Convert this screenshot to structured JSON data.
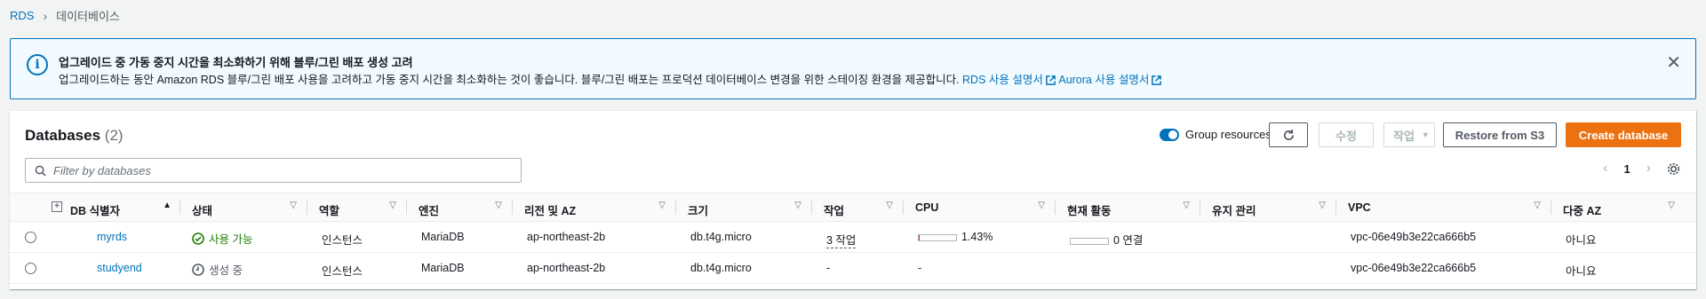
{
  "breadcrumb": {
    "root": "RDS",
    "current": "데이터베이스"
  },
  "banner": {
    "title": "업그레이드 중 가동 중지 시간을 최소화하기 위해 블루/그린 배포 생성 고려",
    "description": "업그레이드하는 동안 Amazon RDS 블루/그린 배포 사용을 고려하고 가동 중지 시간을 최소화하는 것이 좋습니다. 블루/그린 배포는 프로덕션 데이터베이스 변경을 위한 스테이징 환경을 제공합니다.",
    "link_rds": "RDS 사용 설명서",
    "link_aurora": "Aurora 사용 설명서"
  },
  "panel": {
    "title": "Databases",
    "count": "(2)",
    "group_resources": "Group resources",
    "group_resources_on": true,
    "modify_label": "수정",
    "actions_label": "작업",
    "restore_label": "Restore from S3",
    "create_label": "Create database",
    "filter_placeholder": "Filter by databases",
    "page": "1"
  },
  "columns": [
    "DB 식별자",
    "상태",
    "역할",
    "엔진",
    "리전 및 AZ",
    "크기",
    "작업",
    "CPU",
    "현재 활동",
    "유지 관리",
    "VPC",
    "다중 AZ"
  ],
  "rows": [
    {
      "id": "myrds",
      "status": "사용 가능",
      "status_kind": "available",
      "role": "인스턴스",
      "engine": "MariaDB",
      "region": "ap-northeast-2b",
      "size": "db.t4g.micro",
      "actions": "3 작업",
      "cpu": "1.43%",
      "cpu_fraction": 0.0143,
      "activity": "0 연결",
      "maintenance": "",
      "vpc": "vpc-06e49b3e22ca666b5",
      "multi_az": "아니요"
    },
    {
      "id": "studyend",
      "status": "생성 중",
      "status_kind": "creating",
      "role": "인스턴스",
      "engine": "MariaDB",
      "region": "ap-northeast-2b",
      "size": "db.t4g.micro",
      "actions": "-",
      "cpu": "-",
      "cpu_fraction": null,
      "activity": "",
      "maintenance": "",
      "vpc": "vpc-06e49b3e22ca666b5",
      "multi_az": "아니요"
    }
  ],
  "colors": {
    "link": "#0073bb",
    "primary": "#ec7211",
    "success": "#1d8102"
  }
}
